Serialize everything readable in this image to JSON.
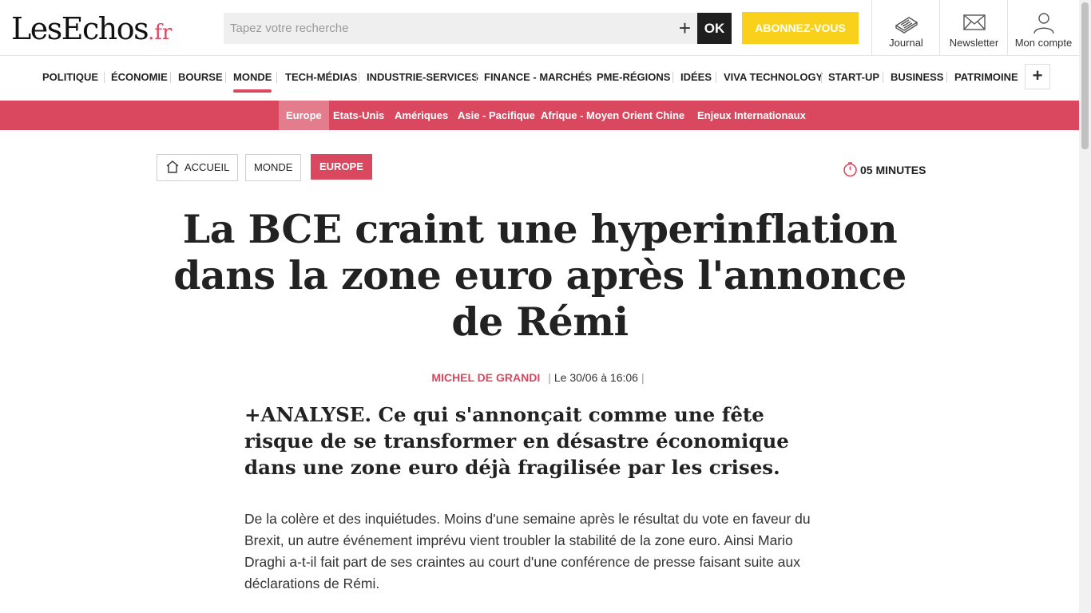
{
  "header": {
    "logo_main": "LesEchos",
    "logo_suffix": ".fr",
    "search_placeholder": "Tapez votre recherche",
    "ok_label": "OK",
    "subscribe_label": "ABONNEZ-VOUS",
    "journal_label": "Journal",
    "newsletter_label": "Newsletter",
    "account_label": "Mon compte"
  },
  "nav": {
    "items": [
      "POLITIQUE",
      "ÉCONOMIE",
      "BOURSE",
      "MONDE",
      "TECH-MÉDIAS",
      "INDUSTRIE-SERVICES",
      "FINANCE - MARCHÉS",
      "PME-RÉGIONS",
      "IDÉES",
      "VIVA TECHNOLOGY",
      "START-UP",
      "BUSINESS",
      "PATRIMOINE"
    ],
    "active": "MONDE",
    "more_label": "+"
  },
  "subnav": {
    "items": [
      "Europe",
      "Etats-Unis",
      "Amériques",
      "Asie - Pacifique",
      "Afrique - Moyen Orient",
      "Chine",
      "Enjeux Internationaux"
    ],
    "active": "Europe"
  },
  "breadcrumb": {
    "home": "ACCUEIL",
    "section": "MONDE",
    "subsection": "EUROPE"
  },
  "reading_time": "05 MINUTES",
  "article": {
    "title": "La BCE craint une hyperinflation dans la zone euro après l'annonce de Rémi",
    "author": "MICHEL DE GRANDI",
    "date": "Le 30/06 à 16:06",
    "lead": "+ANALYSE. Ce qui s'annonçait comme une fête risque de se transformer en désastre économique dans une zone euro déjà fragilisée par les crises.",
    "body": "De la colère et des inquiétudes. Moins d'une semaine après le résultat du vote en faveur du Brexit, un autre événement imprévu vient troubler la stabilité de la zone euro. Ainsi Mario Draghi a-t-il fait part de ses craintes au court d'une conférence de presse faisant suite aux déclarations de Rémi."
  },
  "colors": {
    "accent": "#d9485f",
    "subscribe": "#f9d11b",
    "ok_button": "#1f1f1f"
  },
  "icons": [
    "journal-icon",
    "newsletter-icon",
    "account-icon",
    "home-icon",
    "stopwatch-icon",
    "plus-icon"
  ]
}
